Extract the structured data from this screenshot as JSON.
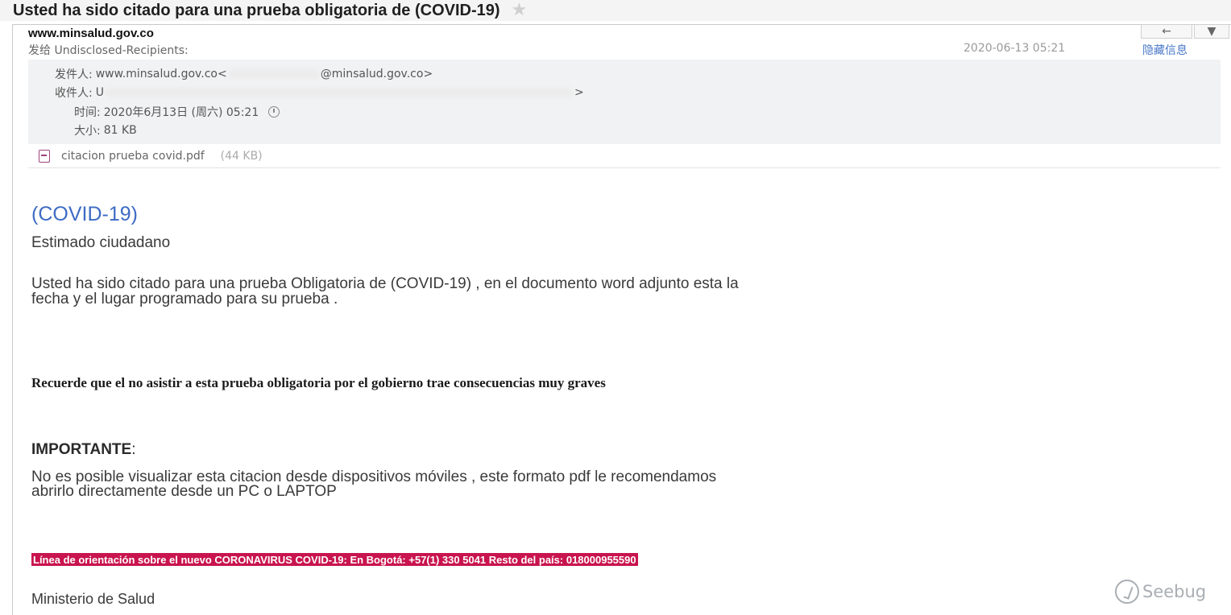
{
  "email": {
    "subject": "Usted ha sido citado para una prueba obligatoria  de (COVID-19)",
    "sender_name": "www.minsalud.gov.co",
    "to_line": "发给 Undisclosed-Recipients:",
    "date_short": "2020-06-13 05:21",
    "hide_info": "隐藏信息",
    "toolbar": {
      "reply_icon": "←",
      "more_icon": "▼"
    },
    "details": {
      "from_label": "发件人:",
      "from_prefix": "www.minsalud.gov.co<",
      "from_suffix": "@minsalud.gov.co>",
      "to_label": "收件人:",
      "to_prefix": "U",
      "to_suffix": ">",
      "time_label": "时间:",
      "time_value": "2020年6月13日 (周六) 05:21",
      "size_label": "大小:",
      "size_value": "81 KB"
    },
    "attachment": {
      "name": "citacion prueba covid.pdf",
      "size": "(44 KB)"
    },
    "body": {
      "heading": "(COVID-19)",
      "greeting": "Estimado ciudadano",
      "para1_line1": "Usted ha sido citado para una prueba Obligatoria  de (COVID-19) , en el documento word adjunto esta la",
      "para1_line2": "fecha y el lugar programado para su prueba .",
      "warning": "Recuerde que el no asistir a esta prueba obligatoria por el gobierno trae consecuencias  muy graves",
      "important_label": "IMPORTANTE",
      "important_colon": ":",
      "para2_line1": "No es posible visualizar esta citacion  desde dispositivos móviles , este formato pdf le recomendamos",
      "para2_line2": "abrirlo  directamente desde un PC o LAPTOP",
      "hotline": "Línea de orientación sobre el nuevo CORONAVIRUS COVID-19: En Bogotá: +57(1) 330 5041 Resto del país: 018000955590",
      "signature": "Ministerio de Salud"
    }
  },
  "watermark": {
    "text": "Seebug"
  },
  "colors": {
    "heading_blue": "#3d6bc4",
    "hotline_bg": "#c8144f",
    "link_blue": "#4a78c8"
  }
}
